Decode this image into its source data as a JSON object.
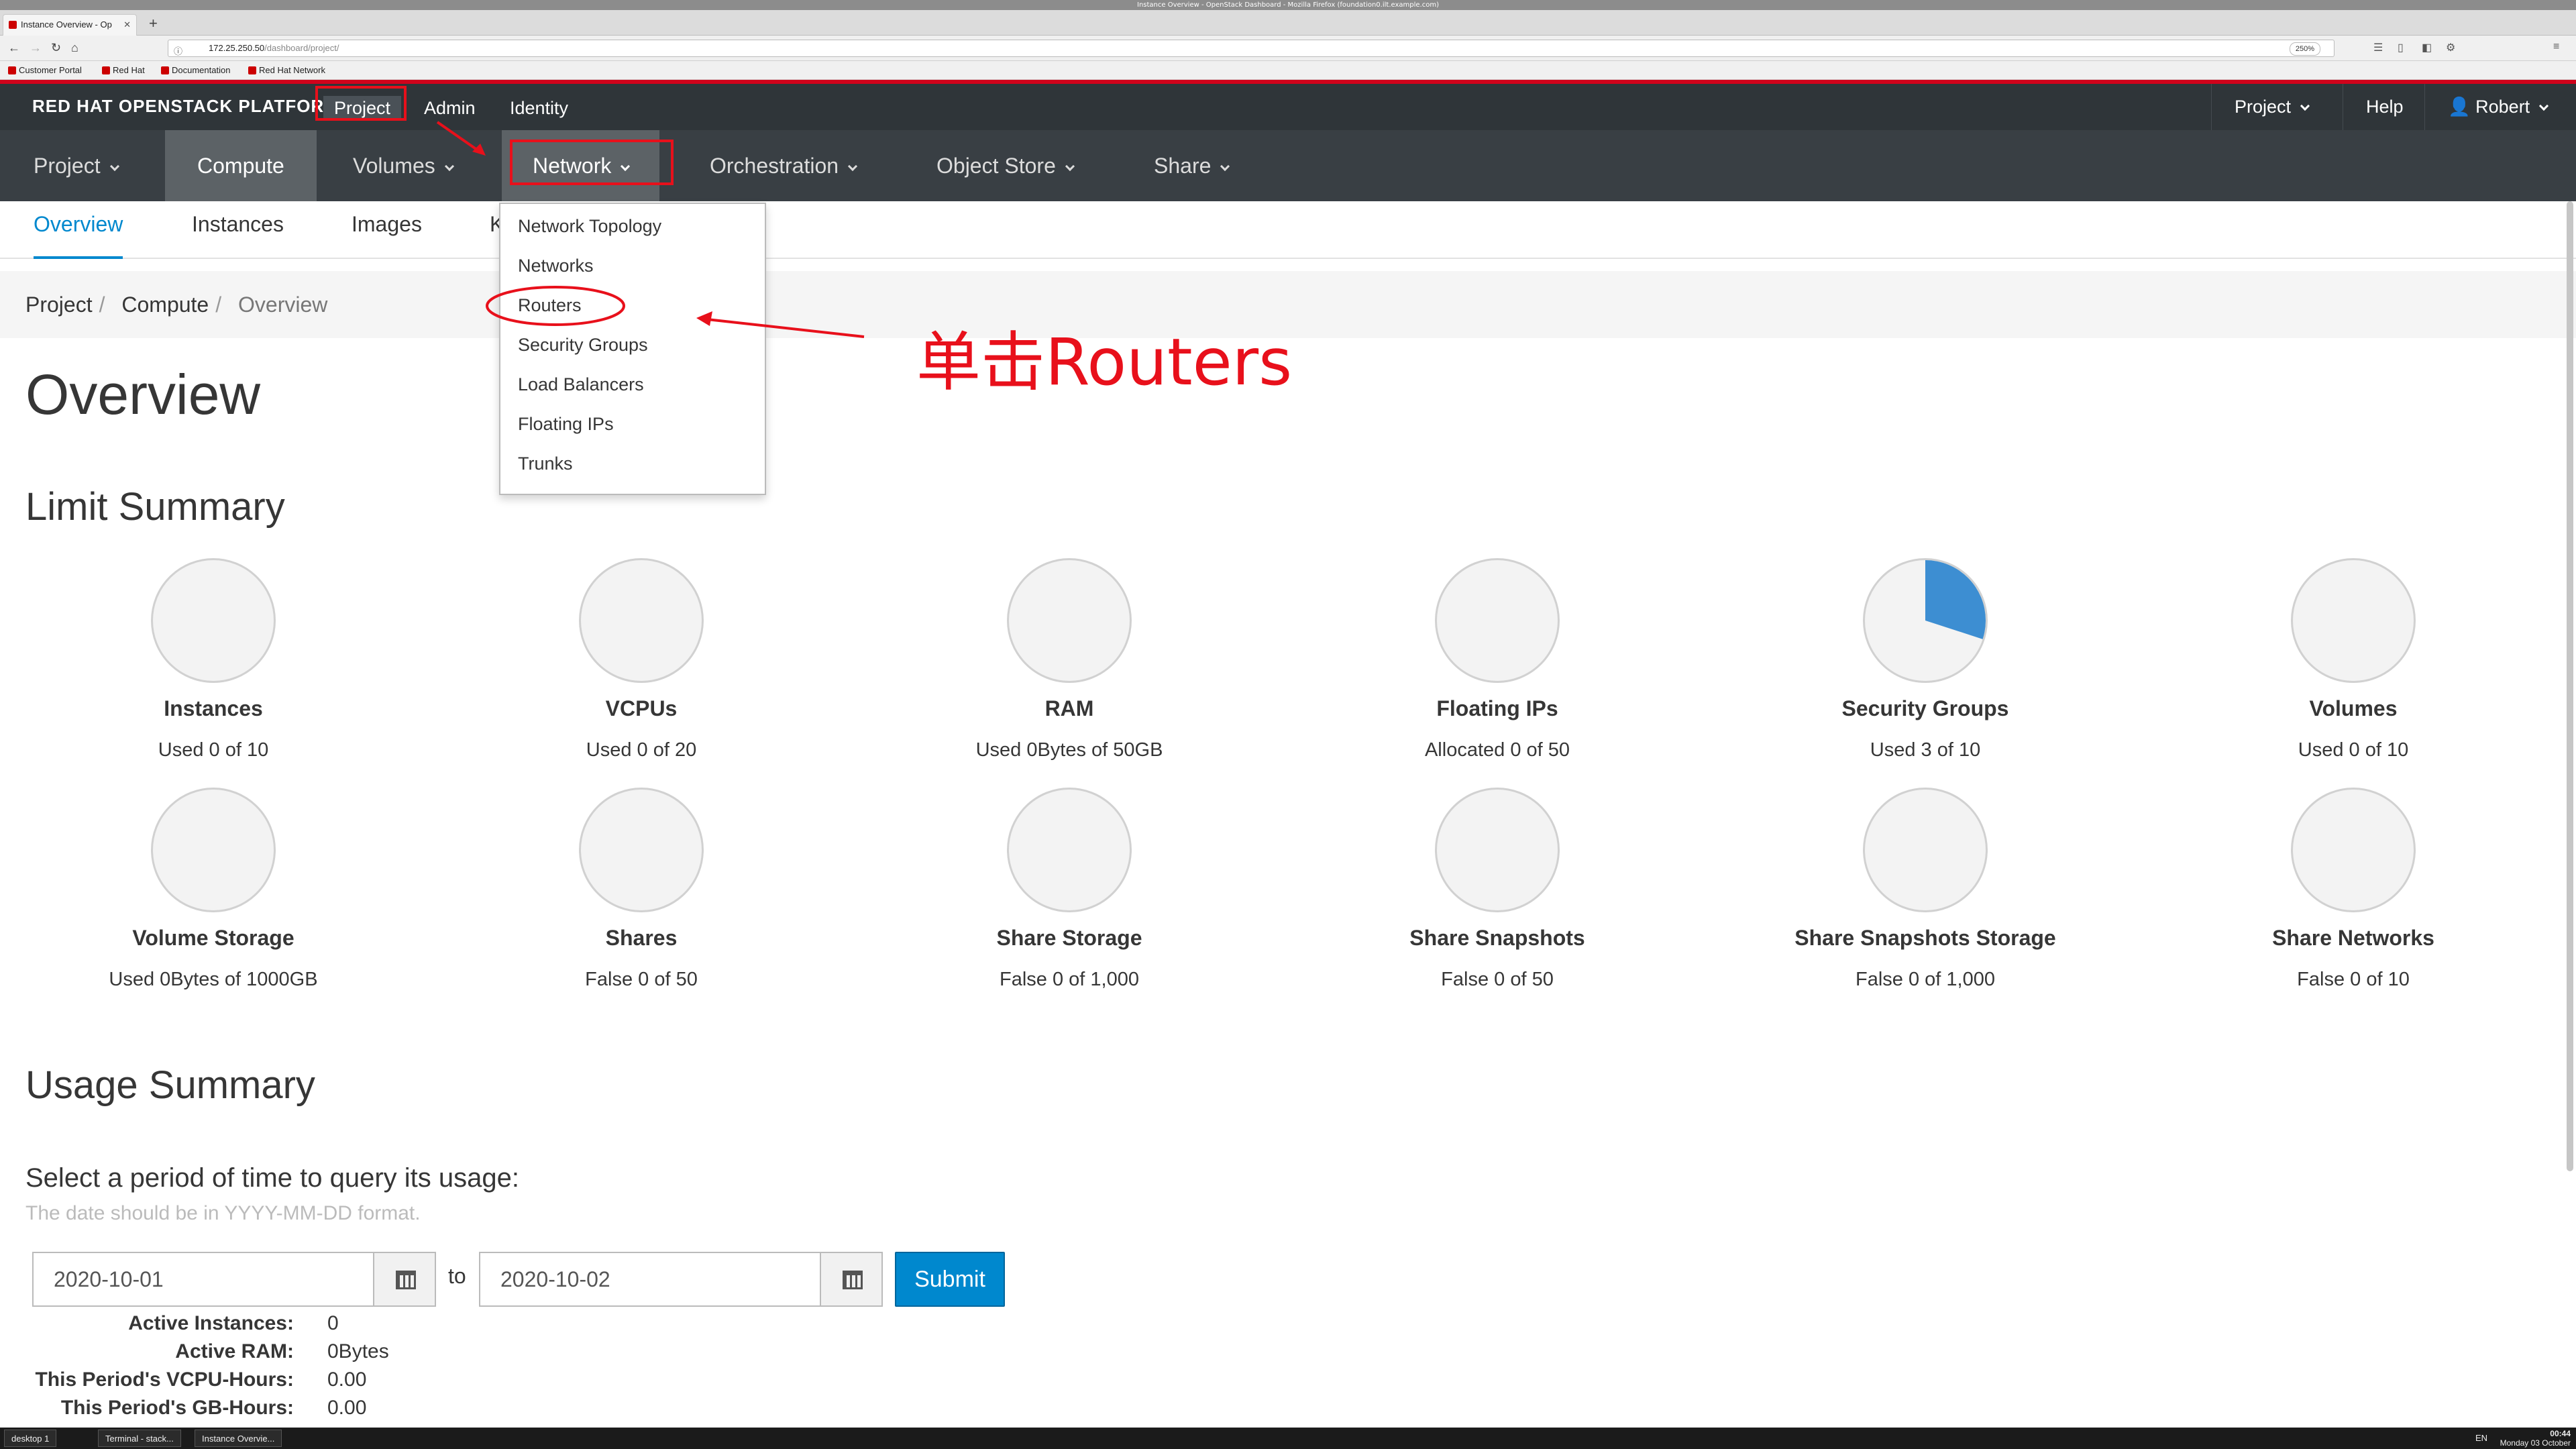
{
  "browser": {
    "window_title": "Instance Overview - OpenStack Dashboard - Mozilla Firefox (foundation0.ilt.example.com)",
    "tab_title": "Instance Overview - Op",
    "url_host": "172.25.250.50",
    "url_path": "/dashboard/project/",
    "zoom": "250%",
    "bookmarks": [
      "Customer Portal",
      "Red Hat",
      "Documentation",
      "Red Hat Network"
    ]
  },
  "topbar": {
    "brand": "RED HAT OPENSTACK PLATFORM",
    "nav": [
      "Project",
      "Admin",
      "Identity"
    ],
    "right": {
      "project": "Project",
      "help": "Help",
      "user": "Robert"
    }
  },
  "secnav": [
    "Project",
    "Compute",
    "Volumes",
    "Network",
    "Orchestration",
    "Object Store",
    "Share"
  ],
  "subnav": [
    "Overview",
    "Instances",
    "Images",
    "K"
  ],
  "breadcrumb": [
    "Project",
    "Compute",
    "Overview"
  ],
  "page_title": "Overview",
  "limit_summary": {
    "title": "Limit Summary",
    "items": [
      {
        "label": "Instances",
        "value": "Used 0 of 10",
        "fraction": 0
      },
      {
        "label": "VCPUs",
        "value": "Used 0 of 20",
        "fraction": 0
      },
      {
        "label": "RAM",
        "value": "Used 0Bytes of 50GB",
        "fraction": 0
      },
      {
        "label": "Floating IPs",
        "value": "Allocated 0 of 50",
        "fraction": 0
      },
      {
        "label": "Security Groups",
        "value": "Used 3 of 10",
        "fraction": 0.3
      },
      {
        "label": "Volumes",
        "value": "Used 0 of 10",
        "fraction": 0
      },
      {
        "label": "Volume Storage",
        "value": "Used 0Bytes of 1000GB",
        "fraction": 0
      },
      {
        "label": "Shares",
        "value": "False 0 of 50",
        "fraction": 0
      },
      {
        "label": "Share Storage",
        "value": "False 0 of 1,000",
        "fraction": 0
      },
      {
        "label": "Share Snapshots",
        "value": "False 0 of 50",
        "fraction": 0
      },
      {
        "label": "Share Snapshots Storage",
        "value": "False 0 of 1,000",
        "fraction": 0
      },
      {
        "label": "Share Networks",
        "value": "False 0 of 10",
        "fraction": 0
      }
    ]
  },
  "usage_summary": {
    "title": "Usage Summary",
    "query_label": "Select a period of time to query its usage:",
    "hint": "The date should be in YYYY-MM-DD format.",
    "start_date": "2020-10-01",
    "to_label": "to",
    "end_date": "2020-10-02",
    "submit_label": "Submit",
    "stats": [
      {
        "label": "Active Instances:",
        "value": "0"
      },
      {
        "label": "Active RAM:",
        "value": "0Bytes"
      },
      {
        "label": "This Period's VCPU-Hours:",
        "value": "0.00"
      },
      {
        "label": "This Period's GB-Hours:",
        "value": "0.00"
      }
    ]
  },
  "network_dropdown": [
    "Network Topology",
    "Networks",
    "Routers",
    "Security Groups",
    "Load Balancers",
    "Floating IPs",
    "Trunks"
  ],
  "annotation": {
    "text": "单击Routers",
    "color": "#e8101b"
  },
  "colors": {
    "accent": "#0088ce",
    "pie_fill": "#3d8ed2",
    "topbar": "#2f3539",
    "brand_red": "#d0021b"
  },
  "taskbar": {
    "items": [
      "desktop 1",
      "Terminal - stack...",
      "Instance Overvie..."
    ],
    "time": "00:44",
    "date": "Monday 03 October",
    "lang": "EN"
  }
}
